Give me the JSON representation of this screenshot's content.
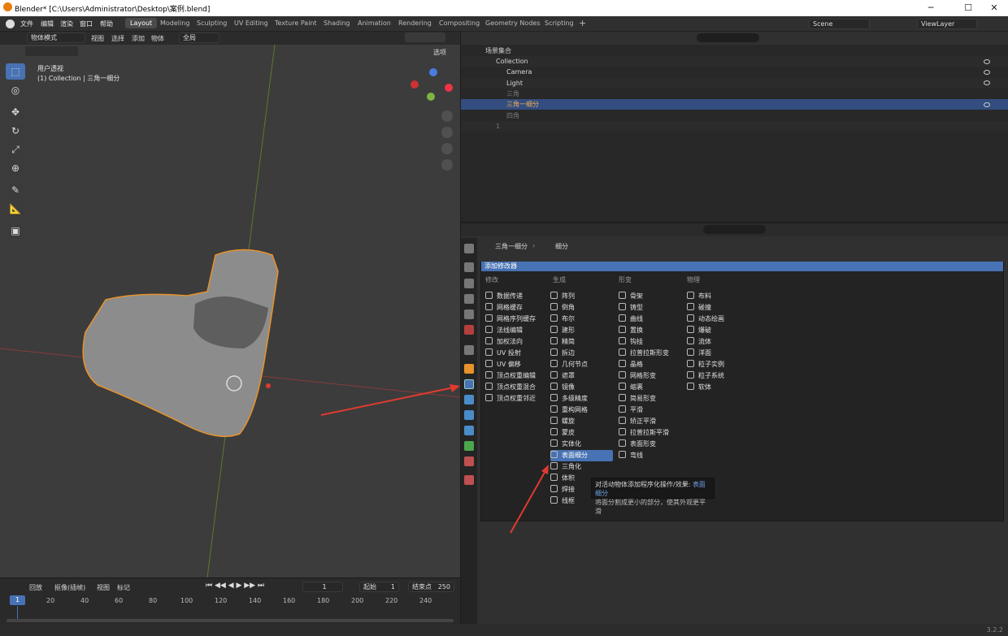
{
  "window": {
    "title": "Blender* [C:\\Users\\Administrator\\Desktop\\案例.blend]"
  },
  "menus": [
    "文件",
    "编辑",
    "渲染",
    "窗口",
    "帮助"
  ],
  "workspaces": [
    "Layout",
    "Modeling",
    "Sculpting",
    "UV Editing",
    "Texture Paint",
    "Shading",
    "Animation",
    "Rendering",
    "Compositing",
    "Geometry Nodes",
    "Scripting"
  ],
  "active_workspace": "Layout",
  "scene": "Scene",
  "view_layer": "ViewLayer",
  "viewport": {
    "mode": "物体模式",
    "menus": [
      "视图",
      "选择",
      "添加",
      "物体"
    ],
    "transform": "全局",
    "options": "选项",
    "view_name": "用户透视",
    "object_info": "(1) Collection | 三角一细分"
  },
  "timeline": {
    "menus": [
      "回放",
      "抠像(插帧)",
      "视图",
      "标记"
    ],
    "current_frame": "1",
    "start_label": "起始",
    "start": "1",
    "end_label": "结束点",
    "end": "250",
    "ticks": [
      "1",
      "20",
      "40",
      "60",
      "80",
      "100",
      "120",
      "140",
      "160",
      "180",
      "200",
      "220",
      "240"
    ]
  },
  "outliner": {
    "root": "场景集合",
    "collection": "Collection",
    "items": [
      "Camera",
      "Light",
      "三角",
      "三角一细分",
      "四角"
    ],
    "extra": "1"
  },
  "properties": {
    "breadcrumb_object": "三角一细分",
    "breadcrumb_modifier": "细分",
    "add_modifier": "添加修改器",
    "categories": [
      "修改",
      "生成",
      "形变",
      "物理"
    ],
    "col_modify": [
      "数据传递",
      "网格缓存",
      "网格序列缓存",
      "法线编辑",
      "加权法向",
      "UV 投射",
      "UV 偏移",
      "顶点权重编辑",
      "顶点权重混合",
      "顶点权重邻近"
    ],
    "col_generate": [
      "阵列",
      "倒角",
      "布尔",
      "建形",
      "精简",
      "拆边",
      "几何节点",
      "遮罩",
      "镜像",
      "多级精度",
      "重构网格",
      "螺旋",
      "蒙皮",
      "实体化",
      "表面细分",
      "三角化",
      "体积",
      "焊接",
      "线框"
    ],
    "col_deform": [
      "骨架",
      "铸型",
      "曲线",
      "置换",
      "钩挂",
      "拉普拉斯形变",
      "晶格",
      "网格形变",
      "缩裹",
      "简易形变",
      "平滑",
      "矫正平滑",
      "拉普拉斯平滑",
      "表面形变",
      "弯线"
    ],
    "col_physics": [
      "布料",
      "碰撞",
      "动态绘画",
      "爆破",
      "流体",
      "洋面",
      "粒子实例",
      "粒子系统",
      "软体"
    ],
    "highlighted": "表面细分",
    "tooltip_line1_prefix": "对活动物体添加程序化操作/效果:",
    "tooltip_line1_value": "表面细分",
    "tooltip_line2": "将面分割成更小的部分，使其外观更平滑"
  },
  "version": "3.2.2",
  "colors": {
    "accent": "#4772b3",
    "selection_outline": "#e8922a",
    "annotation": "#e03a2f"
  }
}
